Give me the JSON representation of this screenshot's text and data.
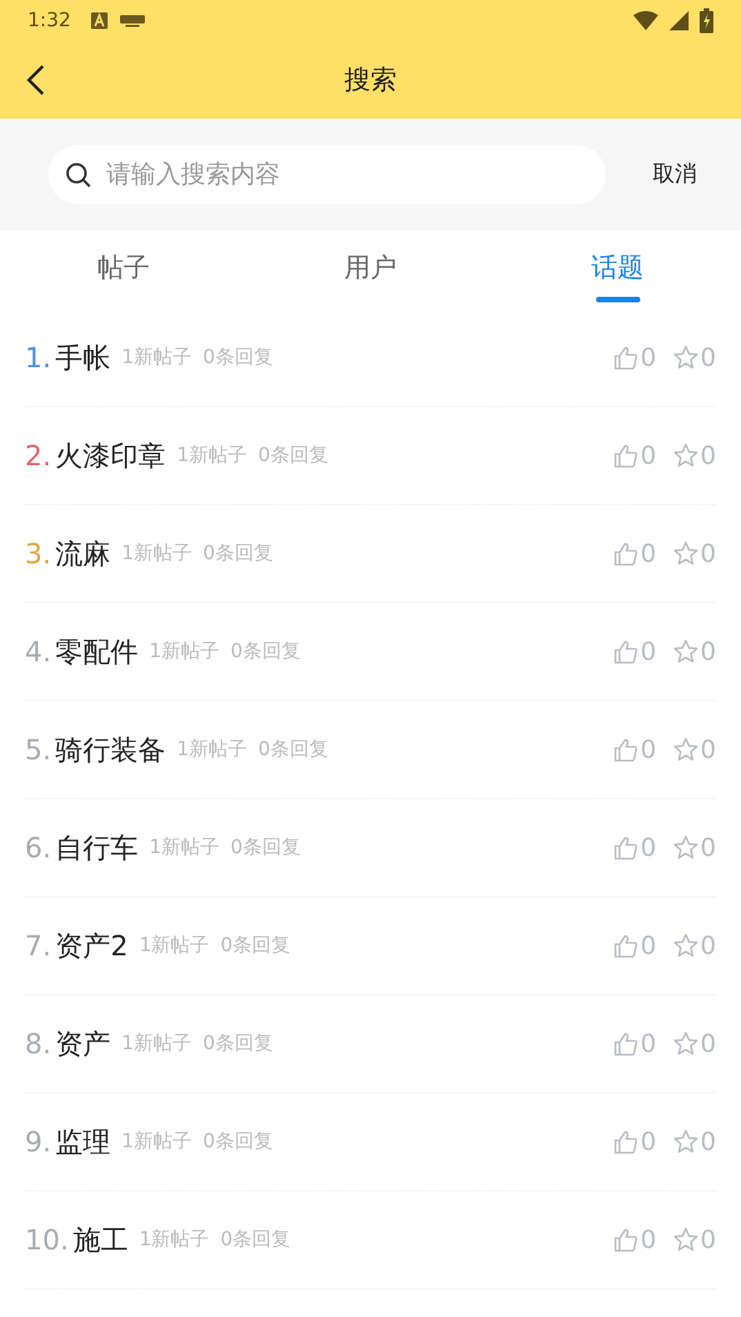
{
  "status_bar": {
    "time": "1:32"
  },
  "app_bar": {
    "title": "搜索"
  },
  "search": {
    "placeholder": "请输入搜索内容",
    "cancel": "取消"
  },
  "tabs": [
    {
      "label": "帖子",
      "selected": false
    },
    {
      "label": "用户",
      "selected": false
    },
    {
      "label": "话题",
      "selected": true
    }
  ],
  "topics": [
    {
      "rank": "1.",
      "name": "手帐",
      "posts": "1新帖子",
      "replies": "0条回复",
      "likes": "0",
      "stars": "0",
      "color": "#4a90e2"
    },
    {
      "rank": "2.",
      "name": "火漆印章",
      "posts": "1新帖子",
      "replies": "0条回复",
      "likes": "0",
      "stars": "0",
      "color": "#e06666"
    },
    {
      "rank": "3.",
      "name": "流麻",
      "posts": "1新帖子",
      "replies": "0条回复",
      "likes": "0",
      "stars": "0",
      "color": "#e0a840"
    },
    {
      "rank": "4.",
      "name": "零配件",
      "posts": "1新帖子",
      "replies": "0条回复",
      "likes": "0",
      "stars": "0",
      "color": "#a8acb3"
    },
    {
      "rank": "5.",
      "name": "骑行装备",
      "posts": "1新帖子",
      "replies": "0条回复",
      "likes": "0",
      "stars": "0",
      "color": "#a8acb3"
    },
    {
      "rank": "6.",
      "name": "自行车",
      "posts": "1新帖子",
      "replies": "0条回复",
      "likes": "0",
      "stars": "0",
      "color": "#a8acb3"
    },
    {
      "rank": "7.",
      "name": "资产2",
      "posts": "1新帖子",
      "replies": "0条回复",
      "likes": "0",
      "stars": "0",
      "color": "#a8acb3"
    },
    {
      "rank": "8.",
      "name": "资产",
      "posts": "1新帖子",
      "replies": "0条回复",
      "likes": "0",
      "stars": "0",
      "color": "#a8acb3"
    },
    {
      "rank": "9.",
      "name": "监理",
      "posts": "1新帖子",
      "replies": "0条回复",
      "likes": "0",
      "stars": "0",
      "color": "#a8acb3"
    },
    {
      "rank": "10.",
      "name": "施工",
      "posts": "1新帖子",
      "replies": "0条回复",
      "likes": "0",
      "stars": "0",
      "color": "#a8acb3"
    }
  ]
}
